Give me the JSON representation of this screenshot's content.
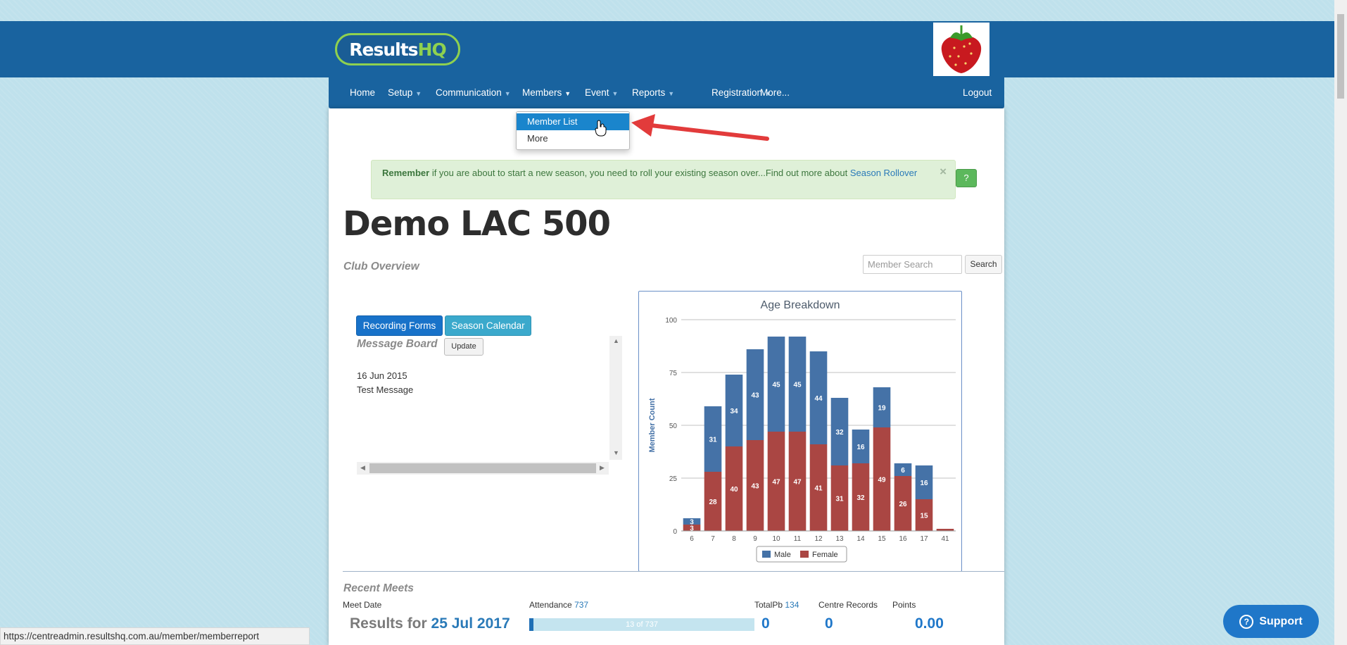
{
  "header": {
    "logo_main": "Results",
    "logo_accent": "HQ",
    "club_logo_icon": "strawberry-icon"
  },
  "nav": {
    "items": [
      {
        "label": "Home",
        "has_caret": false
      },
      {
        "label": "Setup",
        "has_caret": true
      },
      {
        "label": "Communication",
        "has_caret": true
      },
      {
        "label": "Members",
        "has_caret": true
      },
      {
        "label": "Event",
        "has_caret": true
      },
      {
        "label": "Reports",
        "has_caret": true
      },
      {
        "label": "Registration",
        "has_caret": true
      },
      {
        "label": "More...",
        "has_caret": false
      }
    ],
    "logout": "Logout"
  },
  "members_dropdown": {
    "items": [
      "Member List",
      "More"
    ],
    "highlighted": "Member List"
  },
  "alert": {
    "strong": "Remember",
    "text": " if you are about to start a new season, you need to roll your existing season over...Find out more about ",
    "link": "Season Rollover",
    "close": "×",
    "help": "?"
  },
  "page": {
    "title": "Demo LAC 500",
    "subtitle": "Club Overview"
  },
  "search": {
    "placeholder": "Member Search",
    "button": "Search"
  },
  "buttons": {
    "recording_forms": "Recording Forms",
    "season_calendar": "Season Calendar"
  },
  "message_board": {
    "title": "Message Board",
    "update": "Update",
    "messages": [
      {
        "date": "16 Jun 2015",
        "text": "Test Message"
      }
    ]
  },
  "chart_data": {
    "type": "bar",
    "stacked": true,
    "title": "Age Breakdown",
    "xlabel": "",
    "ylabel": "Member Count",
    "ylim": [
      0,
      100
    ],
    "yticks": [
      0,
      25,
      50,
      75,
      100
    ],
    "categories": [
      "6",
      "7",
      "8",
      "9",
      "10",
      "11",
      "12",
      "13",
      "14",
      "15",
      "16",
      "17",
      "41"
    ],
    "series": [
      {
        "name": "Female",
        "color": "#aa4643",
        "values": [
          3,
          28,
          40,
          43,
          47,
          47,
          41,
          31,
          32,
          49,
          26,
          15,
          1
        ]
      },
      {
        "name": "Male",
        "color": "#4572a7",
        "values": [
          3,
          31,
          34,
          43,
          45,
          45,
          44,
          32,
          16,
          19,
          6,
          16,
          0
        ]
      }
    ],
    "legend": [
      "Male",
      "Female"
    ],
    "legend_position": "bottom",
    "data_labels": true,
    "grid": true
  },
  "recent_meets": {
    "title": "Recent Meets",
    "col_meet_date": "Meet Date",
    "col_attendance": "Attendance",
    "attendance_total": "737",
    "col_totalpb": "TotalPb",
    "totalpb_value": "134",
    "col_centre_records": "Centre Records",
    "col_points": "Points",
    "row": {
      "label": "Results for",
      "date": "25 Jul 2017",
      "attendance_text": "13 of 737",
      "attendance_fraction": 0.0176,
      "totalpb": "0",
      "centre_records": "0",
      "points": "0.00"
    }
  },
  "status_bar": {
    "url": "https://centreadmin.resultshq.com.au/member/memberreport"
  },
  "support": {
    "label": "Support",
    "icon": "question-circle-icon"
  }
}
